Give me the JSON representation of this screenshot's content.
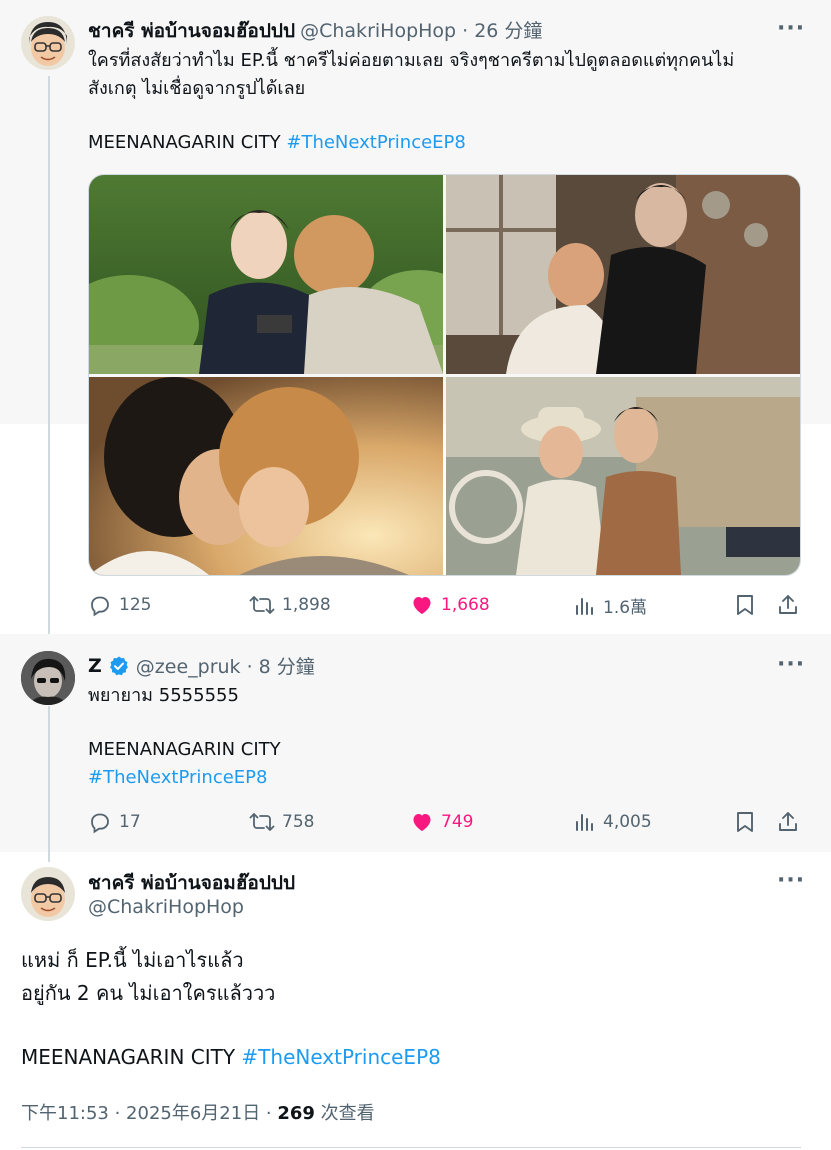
{
  "tweet1": {
    "name": "ชาครี พ่อบ้านจอมฮ๊อปปป",
    "meta": "@ChakriHopHop · 26 分鐘",
    "line1": "ใครที่สงสัยว่าทำไม EP.นี้ ชาครีไม่ค่อยตามเลย จริงๆชาครีตามไปดูตลอดแต่ทุกคนไม่",
    "line2": "สังเกตุ ไม่เชื่อดูจากรูปได้เลย",
    "tag_plain": "MEENANAGARIN CITY ",
    "hashtag": "#TheNextPrinceEP8",
    "replies": "125",
    "retweets": "1,898",
    "likes": "1,668",
    "views": "1.6萬"
  },
  "tweet2": {
    "name": "Z",
    "meta": "@zee_pruk · 8 分鐘",
    "line1": "พยายาม 5555555",
    "tag_plain": "MEENANAGARIN CITY",
    "hashtag": "#TheNextPrinceEP8",
    "replies": "17",
    "retweets": "758",
    "likes": "749",
    "views": "4,005"
  },
  "tweet3": {
    "name": "ชาครี พ่อบ้านจอมฮ๊อปปป",
    "handle": "@ChakriHopHop",
    "line1": "แหม่ ก็ EP.นี้ ไม่เอาไรแล้ว",
    "line2": "อยู่กัน 2 คน ไม่เอาใครแล้ววว",
    "tag_plain": "MEENANAGARIN CITY ",
    "hashtag": "#TheNextPrinceEP8",
    "timestamp": "下午11:53 · 2025年6月21日 · ",
    "view_count": "269",
    "view_label": " 次查看"
  },
  "colors": {
    "accent": "#1d9bf0",
    "like": "#f91880",
    "muted": "#536471",
    "verified": "#1d9bf0"
  },
  "icons": [
    "reply-icon",
    "retweet-icon",
    "like-icon",
    "views-icon",
    "bookmark-icon",
    "share-icon",
    "verified-icon",
    "more-icon"
  ]
}
